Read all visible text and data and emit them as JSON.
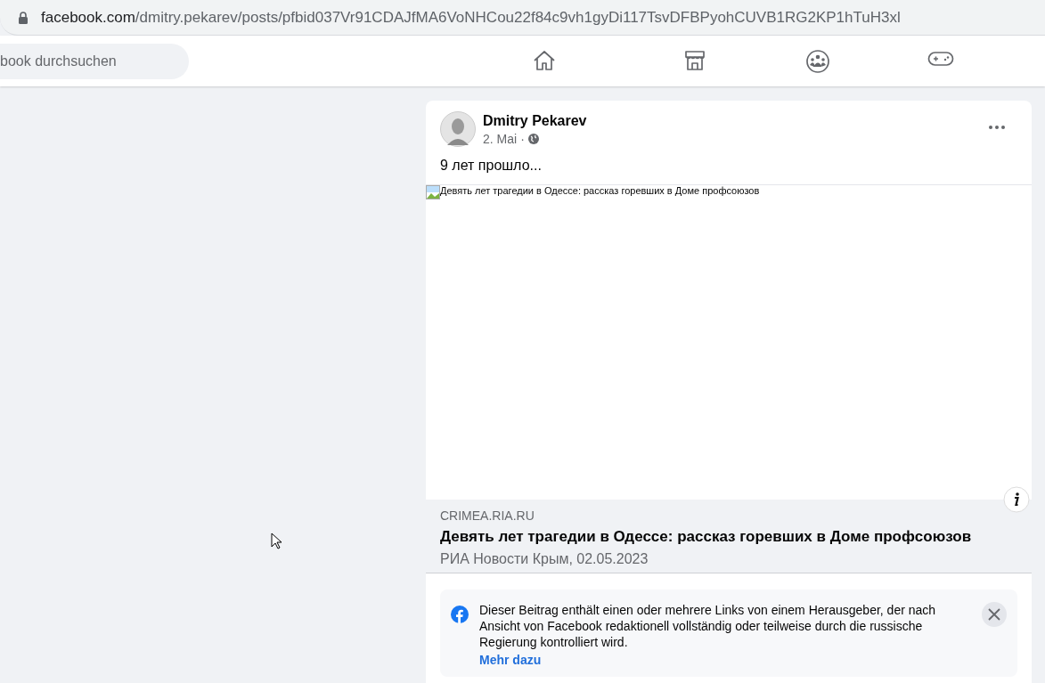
{
  "address_bar": {
    "domain": "facebook.com",
    "path": "/dmitry.pekarev/posts/pfbid037Vr91CDAJfMA6VoNHCou22f84c9vh1gyDi117TsvDFBPyohCUVB1RG2KP1hTuH3xl"
  },
  "search": {
    "placeholder": "book durchsuchen"
  },
  "nav_icons": [
    {
      "kind": "home"
    },
    {
      "kind": "store"
    },
    {
      "kind": "groups"
    },
    {
      "kind": "gaming"
    }
  ],
  "post": {
    "author": "Dmitry Pekarev",
    "date": "2. Mai",
    "separator": "·",
    "text": "9 лет прошло...",
    "image_alt": "Девять лет трагедии в Одессе: рассказ горевших в Доме профсоюзов",
    "link": {
      "domain": "CRIMEA.RIA.RU",
      "title": "Девять лет трагедии в Одессе: рассказ горевших в Доме профсоюзов",
      "source": "РИА Новости Крым, 02.05.2023"
    },
    "notice": {
      "text": "Dieser Beitrag enthält einen oder mehrere Links von einem Herausgeber, der nach Ansicht von Facebook redaktionell vollständig oder teilweise durch die russische Regierung kontrolliert wird.",
      "link": "Mehr dazu"
    }
  }
}
